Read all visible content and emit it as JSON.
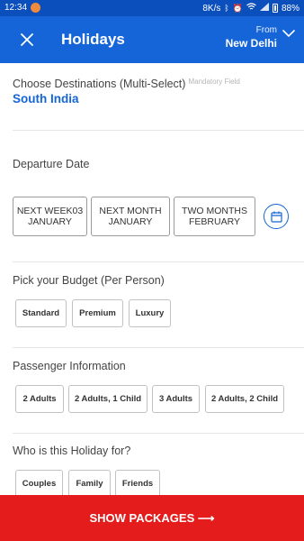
{
  "status_bar": {
    "time": "12:34",
    "net_speed": "8K/s",
    "battery": "88%"
  },
  "header": {
    "title": "Holidays",
    "from_label": "From",
    "from_city": "New Delhi"
  },
  "destination": {
    "label": "Choose Destinations (Multi-Select)",
    "mandatory_note": "Mandatory Field",
    "value": "South India"
  },
  "departure": {
    "label": "Departure Date",
    "options": [
      {
        "line1": "NEXT WEEK03",
        "line2": "JANUARY"
      },
      {
        "line1": "NEXT MONTH",
        "line2": "JANUARY"
      },
      {
        "line1": "TWO MONTHS",
        "line2": "FEBRUARY"
      }
    ]
  },
  "budget": {
    "label": "Pick your Budget (Per Person)",
    "options": [
      "Standard",
      "Premium",
      "Luxury"
    ]
  },
  "passengers": {
    "label": "Passenger Information",
    "options": [
      "2 Adults",
      "2 Adults, 1 Child",
      "3 Adults",
      "2 Adults, 2 Child"
    ]
  },
  "holiday_for": {
    "label": "Who is this Holiday for?",
    "options": [
      "Couples",
      "Family",
      "Friends"
    ]
  },
  "cta": {
    "label": "SHOW PACKAGES ⟶"
  },
  "colors": {
    "header_blue": "#1565d8",
    "status_blue": "#0b4fbd",
    "cta_red": "#e41c1c",
    "accent_blue_text": "#1565d8"
  }
}
